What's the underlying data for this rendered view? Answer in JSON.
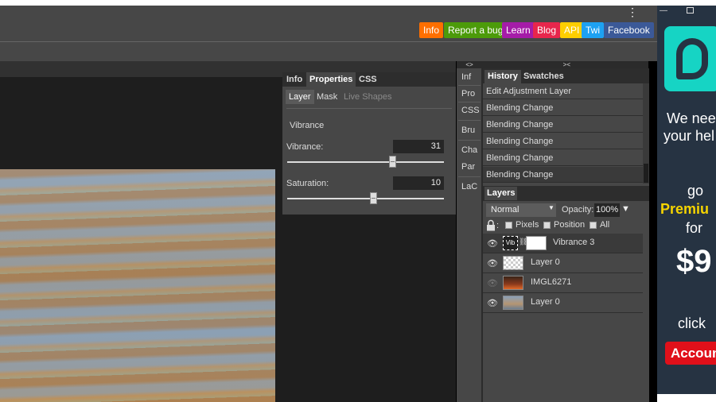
{
  "topbar": {
    "buttons": [
      {
        "label": "Info",
        "color": "#ff6f00"
      },
      {
        "label": "Report a bug",
        "color": "#4c9b0a"
      },
      {
        "label": "Learn",
        "color": "#a51ca8"
      },
      {
        "label": "Blog",
        "color": "#e8264c"
      },
      {
        "label": "API",
        "color": "#ffce00"
      },
      {
        "label": "Twi",
        "color": "#1da1f2"
      },
      {
        "label": "Facebook",
        "color": "#3b5998"
      }
    ]
  },
  "adjustment_panel": {
    "tabs": [
      "Info",
      "Properties",
      "CSS"
    ],
    "active_tab": "Properties",
    "subtabs": [
      "Layer",
      "Mask",
      "Live Shapes"
    ],
    "active_subtab": "Layer",
    "title": "Vibrance",
    "vibrance": {
      "label": "Vibrance:",
      "value": "31",
      "position": 0.67
    },
    "saturation": {
      "label": "Saturation:",
      "value": "10",
      "position": 0.55
    }
  },
  "mini_dock": {
    "collapse_label": "<>",
    "items": [
      "Inf",
      "Pro",
      "CSS",
      "Bru",
      "Cha",
      "Par",
      "LaC"
    ]
  },
  "history_panel": {
    "collapse_label": "><",
    "tabs": [
      "History",
      "Swatches"
    ],
    "active_tab": "History",
    "entries": [
      "Edit Adjustment Layer",
      "Blending Change",
      "Blending Change",
      "Blending Change",
      "Blending Change",
      "Blending Change"
    ]
  },
  "layers_panel": {
    "tab": "Layers",
    "blend_mode": "Normal",
    "opacity_label": "Opacity:",
    "opacity_value": "100%",
    "lock_label": ":",
    "lock_options": [
      "Pixels",
      "Position",
      "All"
    ],
    "layers": [
      {
        "name": "Vibrance 3",
        "visible": true,
        "selected": true,
        "thumb_text": "Vib"
      },
      {
        "name": "Layer 0",
        "visible": true,
        "selected": false
      },
      {
        "name": "IMGL6271",
        "visible": false,
        "selected": false
      },
      {
        "name": "Layer 0",
        "visible": true,
        "selected": false
      }
    ]
  },
  "ad": {
    "line1": "We nee",
    "line2": "your hel",
    "go": "go",
    "premium": "Premiu",
    "for": "for",
    "price": "$9",
    "click": "click",
    "button": "Accoun"
  },
  "icons": {
    "kebab": "kebab-menu-icon",
    "eye": "eye-icon",
    "lock": "lock-icon",
    "minimize": "window-minimize-icon",
    "restore": "window-restore-icon"
  }
}
